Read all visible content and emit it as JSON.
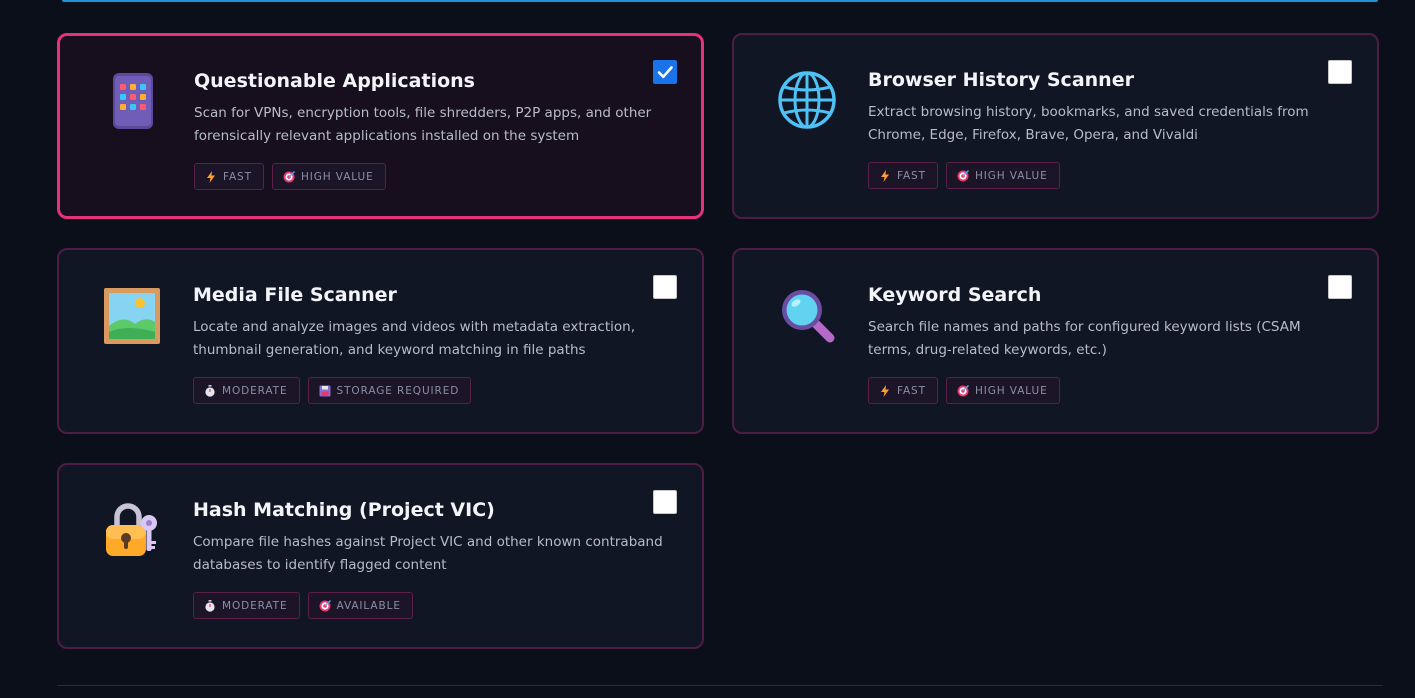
{
  "colors": {
    "accent_selected": "#e6317f",
    "card_border": "#4d1d45",
    "checkbox_checked": "#1a73e8",
    "background": "#0b0f1a"
  },
  "cards": [
    {
      "title": "Questionable Applications",
      "description": "Scan for VPNs, encryption tools, file shredders, P2P apps, and other forensically relevant applications installed on the system",
      "icon": "mobile-phone-icon",
      "selected": true,
      "tags": [
        {
          "icon": "lightning-icon",
          "label": "FAST"
        },
        {
          "icon": "target-icon",
          "label": "HIGH VALUE"
        }
      ]
    },
    {
      "title": "Browser History Scanner",
      "description": "Extract browsing history, bookmarks, and saved credentials from Chrome, Edge, Firefox, Brave, Opera, and Vivaldi",
      "icon": "globe-icon",
      "selected": false,
      "tags": [
        {
          "icon": "lightning-icon",
          "label": "FAST"
        },
        {
          "icon": "target-icon",
          "label": "HIGH VALUE"
        }
      ]
    },
    {
      "title": "Media File Scanner",
      "description": "Locate and analyze images and videos with metadata extraction, thumbnail generation, and keyword matching in file paths",
      "icon": "framed-picture-icon",
      "selected": false,
      "tags": [
        {
          "icon": "stopwatch-icon",
          "label": "MODERATE"
        },
        {
          "icon": "floppy-disk-icon",
          "label": "STORAGE REQUIRED"
        }
      ]
    },
    {
      "title": "Keyword Search",
      "description": "Search file names and paths for configured keyword lists (CSAM terms, drug-related keywords, etc.)",
      "icon": "magnifier-icon",
      "selected": false,
      "tags": [
        {
          "icon": "lightning-icon",
          "label": "FAST"
        },
        {
          "icon": "target-icon",
          "label": "HIGH VALUE"
        }
      ]
    },
    {
      "title": "Hash Matching (Project VIC)",
      "description": "Compare file hashes against Project VIC and other known contraband databases to identify flagged content",
      "icon": "lock-key-icon",
      "selected": false,
      "tags": [
        {
          "icon": "stopwatch-icon",
          "label": "MODERATE"
        },
        {
          "icon": "target-icon",
          "label": "AVAILABLE"
        }
      ]
    }
  ]
}
